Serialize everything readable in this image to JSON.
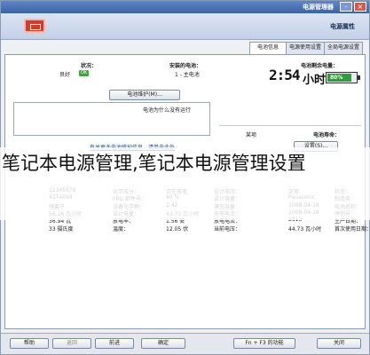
{
  "window": {
    "title": "电源管理器"
  },
  "header": {
    "title": "电源属性"
  },
  "tabs": [
    {
      "label": "电池信息"
    },
    {
      "label": "电源使用设置"
    },
    {
      "label": "全局电源设置"
    }
  ],
  "left": {
    "status_heading": "状况：",
    "status_value": "良好",
    "status_badge": "OK",
    "installed_heading": "安装的电池：",
    "installed_value": "1 - 主电池",
    "details_button": "电池维护(M)...",
    "notes_heading": "电池为什么没有运行",
    "info_link": "有关更多电池维护信息，请单击此处",
    "help_text": "要了解更多电池信息"
  },
  "right": {
    "remaining_heading": "电池剩余电量：",
    "lcd_time": "2:54",
    "lcd_unit": "小时",
    "battery_pct": "80%",
    "battery_fill": 0.8,
    "lifetime_heading": "电池寿命：",
    "lifetime_value": "某项",
    "settings_button": "设置(S)..."
  },
  "details": {
    "col1": [
      "状态：",
      "制造商：",
      "电池名称：",
      "序列号：",
      "生产日期：",
      "首次使用日期："
    ],
    "col2": [
      "正常",
      "Panasonic",
      "2008-04-18",
      "2008-04-18",
      "2313",
      "44.73 瓦小时"
    ],
    "col3": [
      "设计电压：",
      "设计容量：",
      "满充容量：",
      "充电电流：",
      "放电电流：",
      "当前电压："
    ],
    "col4": [
      "正在放电",
      "80 %",
      "2:42",
      "43.73 瓦小时",
      "1.56 安",
      "12.05 伏"
    ],
    "rows2_labels": [
      "化学成分：",
      "FRU 部件号：",
      "设备化学物：",
      "设计电量：",
      "放电率：",
      "温度："
    ],
    "rows2_values": [
      "12345678",
      "42T4694",
      "锂离子",
      "56.16 瓦小时",
      "36.94 瓦",
      "33 摄氏度"
    ]
  },
  "footer": {
    "help": "帮助",
    "back": "返回",
    "forward": "前进",
    "ok": "确定",
    "fn_hint": "Fn + F3 的功能",
    "close": "关闭"
  },
  "overlay": {
    "caption": "笔记本电源管理,笔记本电源管理设置"
  },
  "colors": {
    "accent": "#3a62a8",
    "battery": "#2f9e3a",
    "logo": "#d83a2a"
  }
}
